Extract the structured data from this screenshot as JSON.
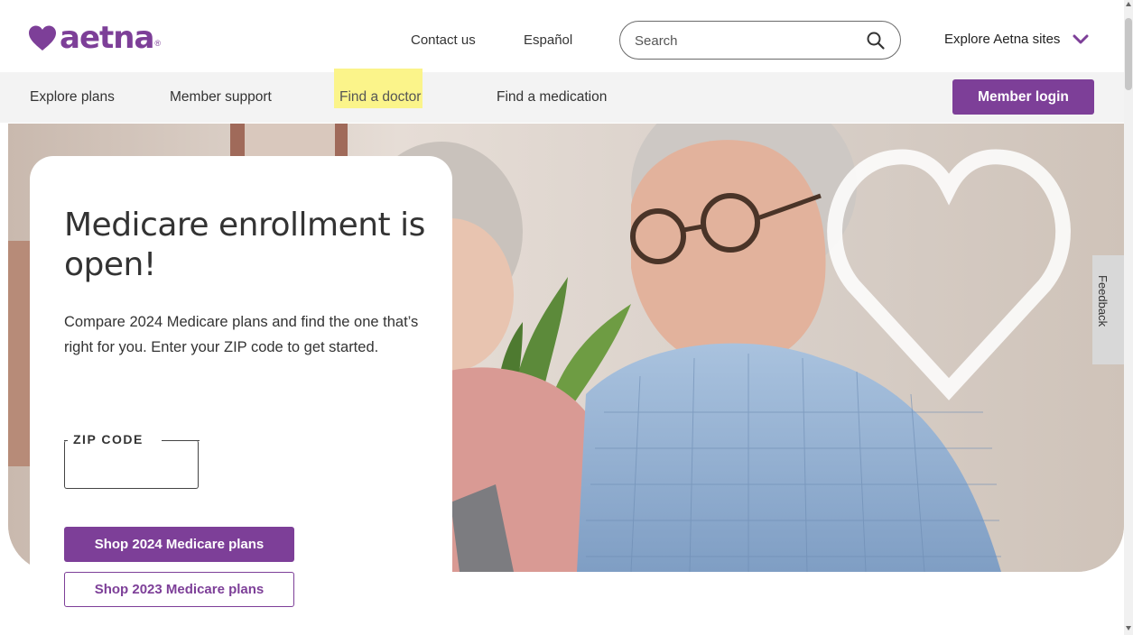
{
  "brand": {
    "name": "aetna",
    "registered": "®",
    "color": "#7d3f98"
  },
  "header": {
    "contact_label": "Contact us",
    "espanol_label": "Español",
    "search_placeholder": "Search",
    "explore_sites_label": "Explore Aetna sites"
  },
  "nav": {
    "items": [
      {
        "label": "Explore plans"
      },
      {
        "label": "Member support"
      },
      {
        "label": "Find a doctor",
        "highlighted": true,
        "highlight_color": "#fbf48a"
      },
      {
        "label": "Find a medication"
      }
    ],
    "login_label": "Member login"
  },
  "hero": {
    "heading": "Medicare enrollment is open!",
    "body": "Compare 2024 Medicare plans and find the one that’s right for you. Enter your ZIP code to get started.",
    "zip_label": "ZIP CODE",
    "zip_value": "",
    "primary_button": "Shop 2024 Medicare plans",
    "secondary_button": "Shop 2023 Medicare plans"
  },
  "feedback_label": "Feedback",
  "icons": {
    "logo": "heart-icon",
    "search": "search-icon",
    "explore": "chevron-down-icon"
  }
}
